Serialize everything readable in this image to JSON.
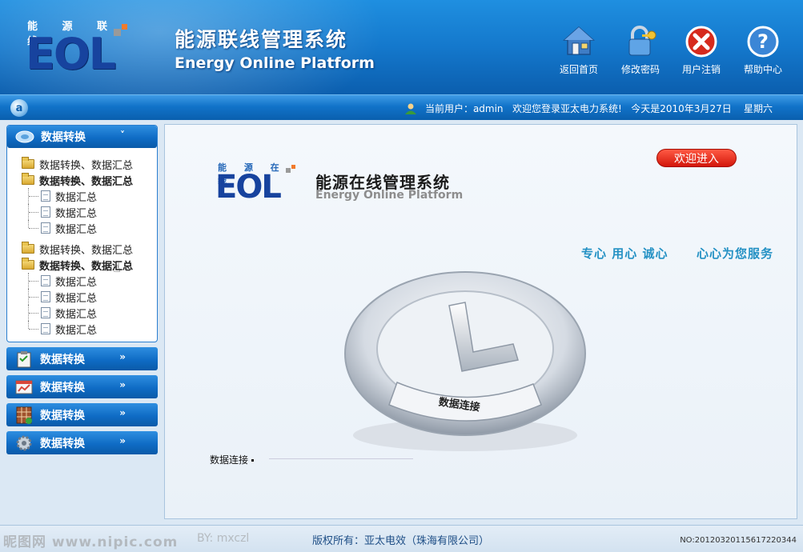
{
  "header": {
    "logo_cn": "能 源 联 线",
    "logo_letters": "EOL",
    "title": "能源联线管理系统",
    "subtitle": "Energy Online Platform",
    "buttons": [
      {
        "label": "返回首页",
        "icon": "home-icon"
      },
      {
        "label": "修改密码",
        "icon": "lock-key-icon"
      },
      {
        "label": "用户注销",
        "icon": "close-circle-icon"
      },
      {
        "label": "帮助中心",
        "icon": "help-icon"
      }
    ]
  },
  "statusbar": {
    "user_label": "当前用户：admin",
    "welcome": "欢迎您登录亚太电力系统!",
    "today": "今天是2010年3月27日",
    "weekday": "星期六"
  },
  "sidebar": {
    "open_section": {
      "title": "数据转换",
      "arrow": "˅",
      "groups": [
        {
          "label": "数据转换、数据汇总",
          "bold": false,
          "leaves": []
        },
        {
          "label": "数据转换、数据汇总",
          "bold": true,
          "leaves": [
            "数据汇总",
            "数据汇总",
            "数据汇总"
          ]
        },
        {
          "label": "数据转换、数据汇总",
          "bold": false,
          "leaves": []
        },
        {
          "label": "数据转换、数据汇总",
          "bold": true,
          "leaves": [
            "数据汇总",
            "数据汇总",
            "数据汇总",
            "数据汇总"
          ]
        }
      ]
    },
    "collapsed_sections": [
      {
        "title": "数据转换",
        "arrow": "»",
        "icon": "clipboard-icon"
      },
      {
        "title": "数据转换",
        "arrow": "»",
        "icon": "chart-panel-icon"
      },
      {
        "title": "数据转换",
        "arrow": "»",
        "icon": "spreadsheet-icon"
      },
      {
        "title": "数据转换",
        "arrow": "»",
        "icon": "gear-icon"
      }
    ]
  },
  "main": {
    "logo_cn": "能 源 在 线",
    "logo_letters": "EOL",
    "title": "能源在线管理系统",
    "subtitle": "Energy Online Platform",
    "enter_button": "欢迎进入",
    "slogan_left": "专心 用心 诚心",
    "slogan_right": "心心为您服务",
    "ring_label": "数据连接",
    "connection_note": "数据连接"
  },
  "footer": {
    "watermark": "昵图网 www.nipic.com",
    "watermark_by": "BY: mxczl",
    "copyright": "版权所有：亚太电效（珠海有限公司）",
    "image_no": "NO:20120320115617220344"
  },
  "colors": {
    "header_blue": "#1478cc",
    "accent_red": "#d3170b",
    "slogan_blue": "#2491c4",
    "logo_navy": "#17439e"
  }
}
